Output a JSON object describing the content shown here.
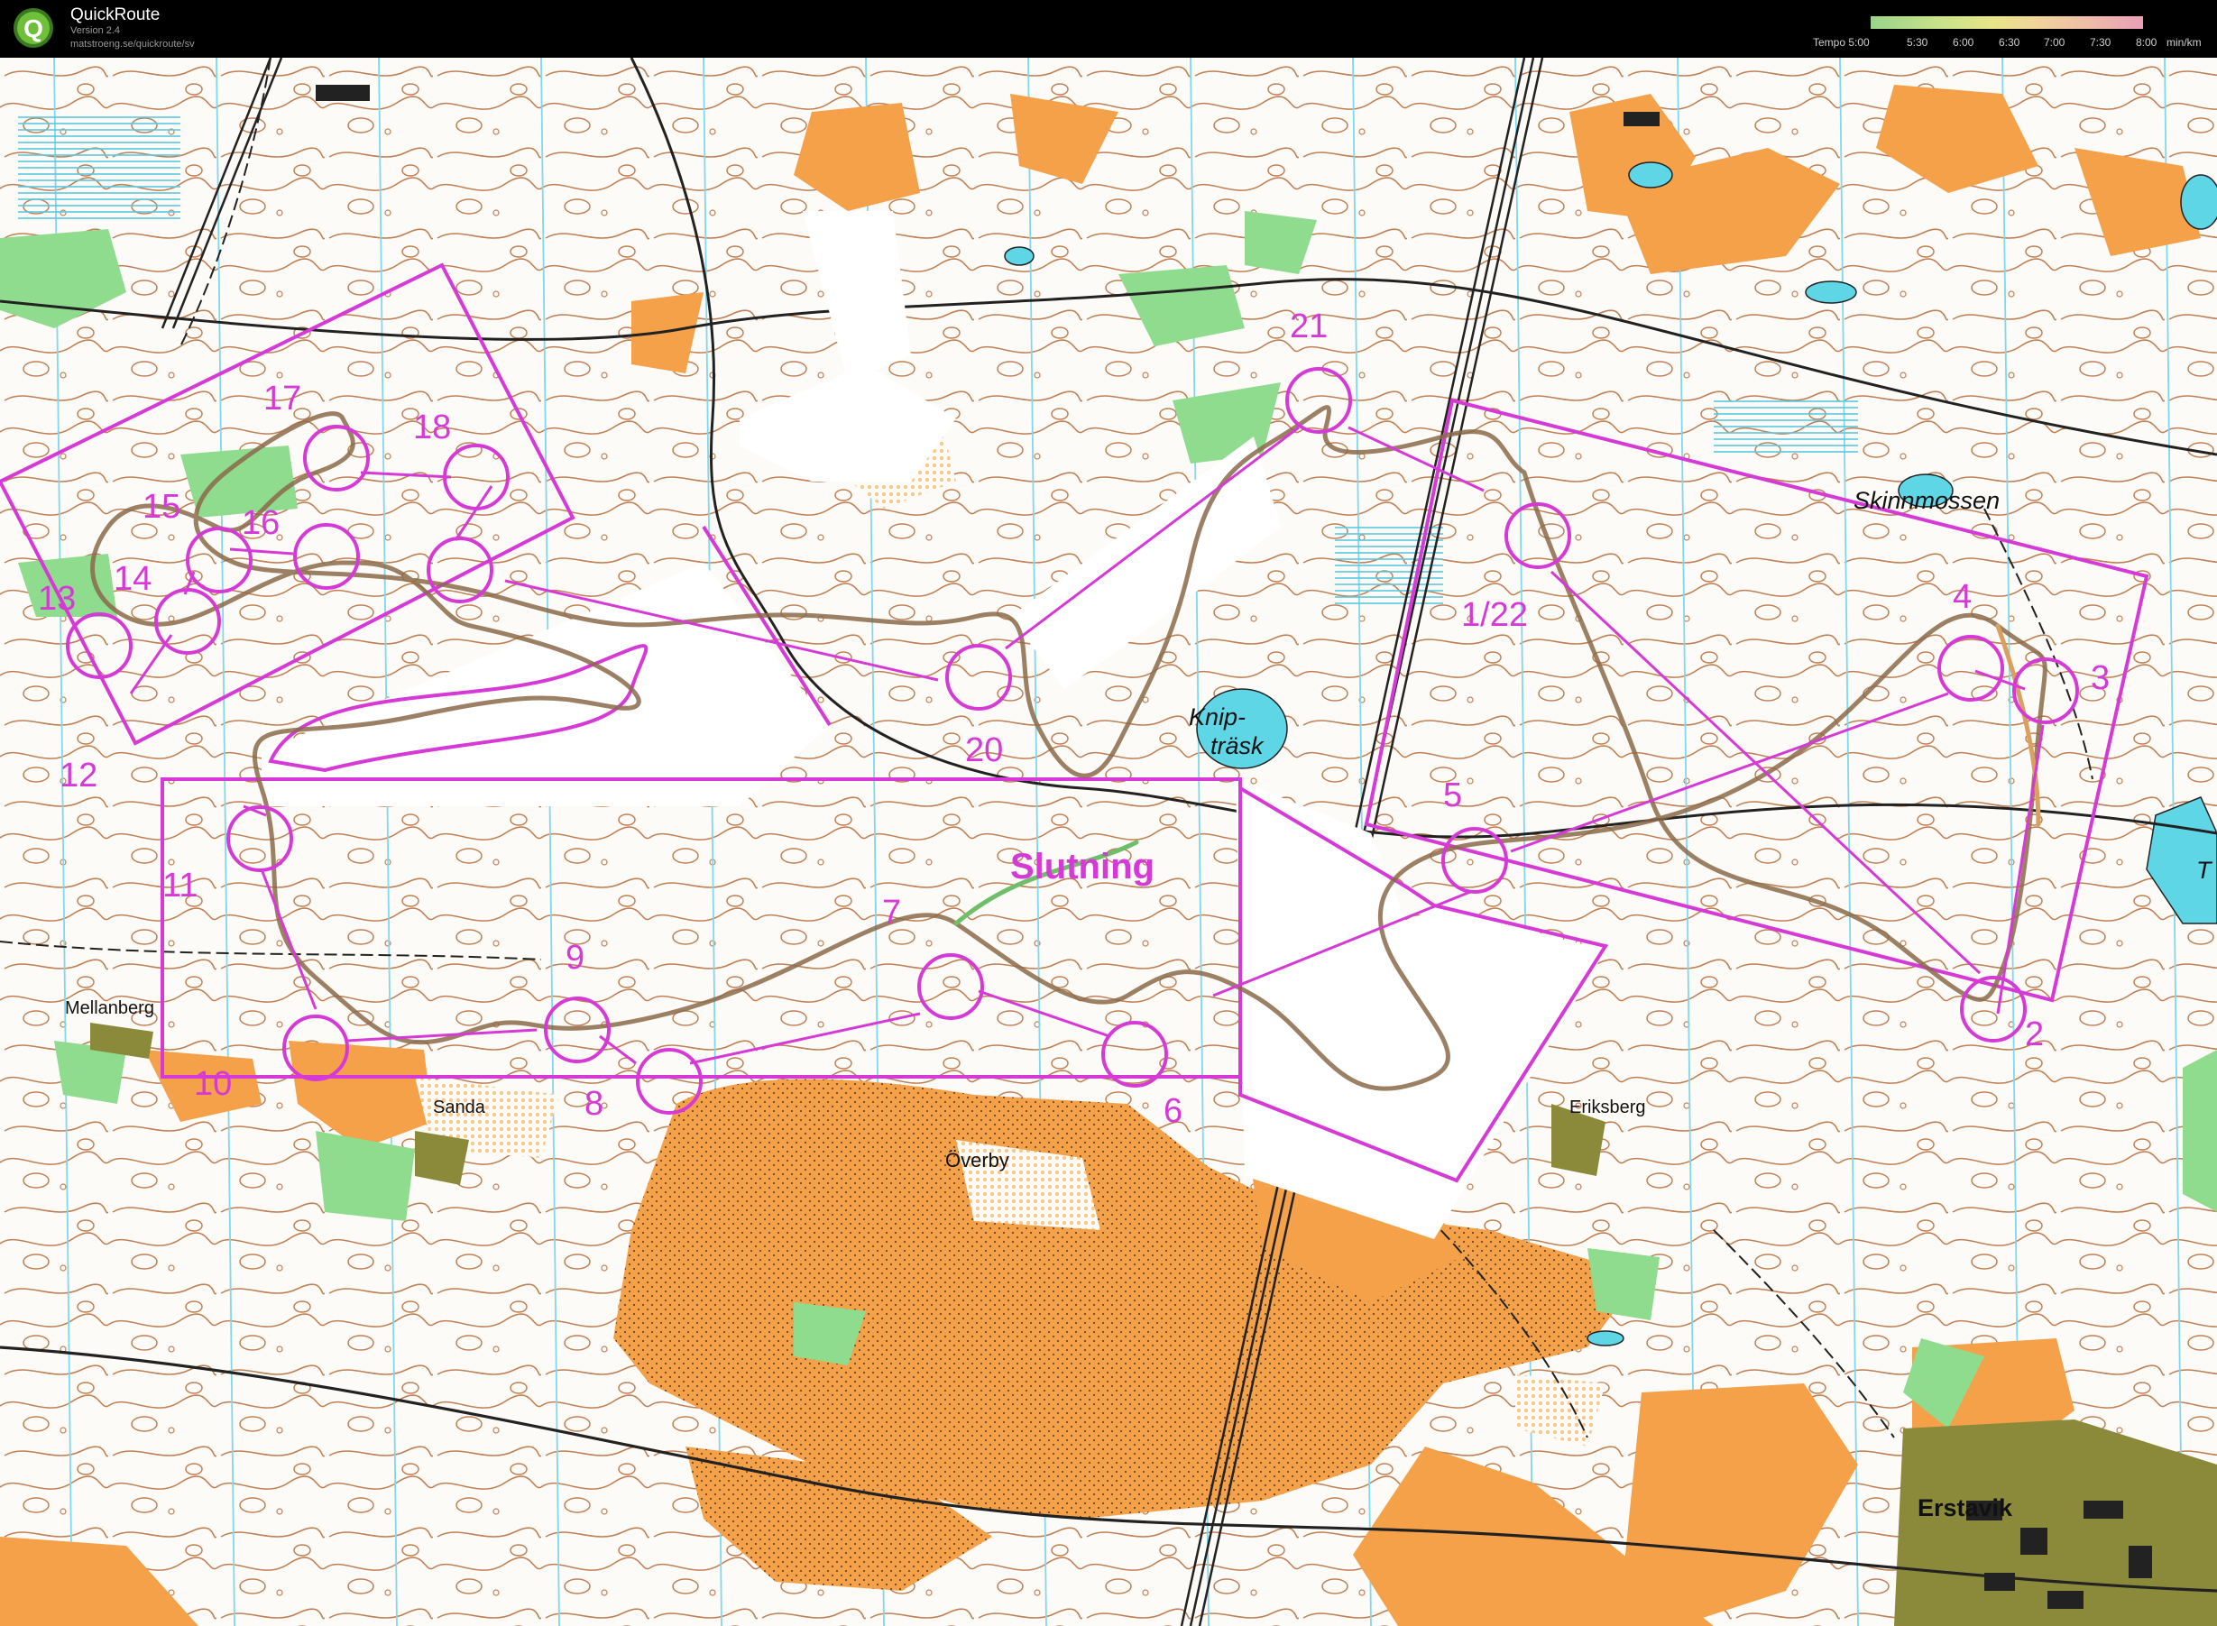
{
  "app": {
    "name": "QuickRoute",
    "version": "Version 2.4",
    "url": "matstroeng.se/quickroute/sv"
  },
  "legend": {
    "title": "Tempo 5:00",
    "ticks": [
      "5:30",
      "6:00",
      "6:30",
      "7:00",
      "7:30",
      "8:00"
    ],
    "unit": "min/km"
  },
  "map": {
    "place_names": {
      "skinnmossen": "Skinnmossen",
      "knip": "Knip-",
      "trask": "träsk",
      "mellanberg": "Mellanberg",
      "sanda": "Sanda",
      "overby": "Överby",
      "eriksberg": "Eriksberg",
      "erstavik": "Erstavik",
      "edge_t": "T"
    },
    "course": {
      "finish_label": "Slutning",
      "controls": [
        "1/22",
        "2",
        "3",
        "4",
        "5",
        "6",
        "7",
        "8",
        "9",
        "10",
        "11",
        "12",
        "13",
        "14",
        "15",
        "16",
        "17",
        "18",
        "20",
        "21"
      ]
    },
    "colors": {
      "course": "#d63ad6",
      "contour": "#b26b3e",
      "open_land": "#f5a14a",
      "green": "#7ed48a",
      "water": "#5fd6e6",
      "route": "#8a7050",
      "background": "#fdfbf7"
    }
  }
}
